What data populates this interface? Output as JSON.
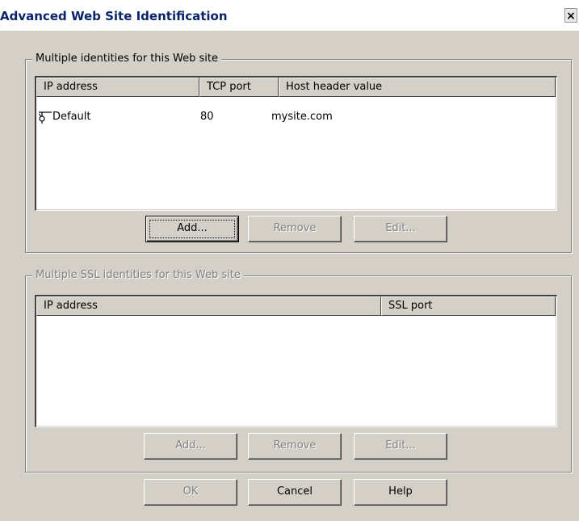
{
  "window": {
    "title": "Advanced Web Site Identification",
    "close_label": "×"
  },
  "identities": {
    "legend": "Multiple identities for this Web site",
    "columns": [
      "IP address",
      "TCP port",
      "Host header value"
    ],
    "rows": [
      {
        "ip": "Default",
        "port": "80",
        "host": "mysite.com",
        "icon": "network-identity-icon"
      }
    ],
    "buttons": {
      "add": "Add...",
      "remove": "Remove",
      "edit": "Edit..."
    }
  },
  "ssl_identities": {
    "legend": "Multiple SSL identities for this Web site",
    "columns": [
      "IP address",
      "SSL port"
    ],
    "rows": [],
    "buttons": {
      "add": "Add...",
      "remove": "Remove",
      "edit": "Edit..."
    }
  },
  "footer": {
    "ok": "OK",
    "cancel": "Cancel",
    "help": "Help"
  }
}
